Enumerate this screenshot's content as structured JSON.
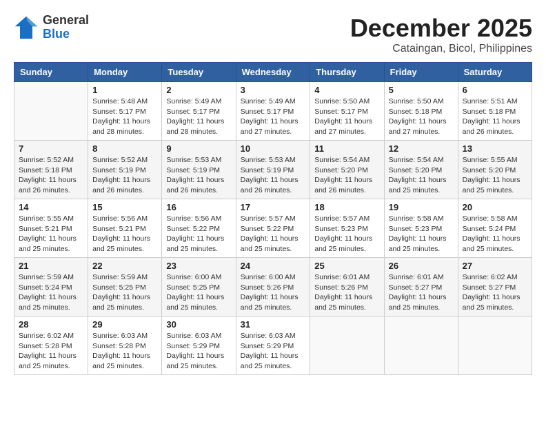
{
  "header": {
    "logo_line1": "General",
    "logo_line2": "Blue",
    "month": "December 2025",
    "location": "Cataingan, Bicol, Philippines"
  },
  "weekdays": [
    "Sunday",
    "Monday",
    "Tuesday",
    "Wednesday",
    "Thursday",
    "Friday",
    "Saturday"
  ],
  "weeks": [
    [
      {
        "day": "",
        "info": ""
      },
      {
        "day": "1",
        "info": "Sunrise: 5:48 AM\nSunset: 5:17 PM\nDaylight: 11 hours and 28 minutes."
      },
      {
        "day": "2",
        "info": "Sunrise: 5:49 AM\nSunset: 5:17 PM\nDaylight: 11 hours and 28 minutes."
      },
      {
        "day": "3",
        "info": "Sunrise: 5:49 AM\nSunset: 5:17 PM\nDaylight: 11 hours and 27 minutes."
      },
      {
        "day": "4",
        "info": "Sunrise: 5:50 AM\nSunset: 5:17 PM\nDaylight: 11 hours and 27 minutes."
      },
      {
        "day": "5",
        "info": "Sunrise: 5:50 AM\nSunset: 5:18 PM\nDaylight: 11 hours and 27 minutes."
      },
      {
        "day": "6",
        "info": "Sunrise: 5:51 AM\nSunset: 5:18 PM\nDaylight: 11 hours and 26 minutes."
      }
    ],
    [
      {
        "day": "7",
        "info": "Sunrise: 5:52 AM\nSunset: 5:18 PM\nDaylight: 11 hours and 26 minutes."
      },
      {
        "day": "8",
        "info": "Sunrise: 5:52 AM\nSunset: 5:19 PM\nDaylight: 11 hours and 26 minutes."
      },
      {
        "day": "9",
        "info": "Sunrise: 5:53 AM\nSunset: 5:19 PM\nDaylight: 11 hours and 26 minutes."
      },
      {
        "day": "10",
        "info": "Sunrise: 5:53 AM\nSunset: 5:19 PM\nDaylight: 11 hours and 26 minutes."
      },
      {
        "day": "11",
        "info": "Sunrise: 5:54 AM\nSunset: 5:20 PM\nDaylight: 11 hours and 26 minutes."
      },
      {
        "day": "12",
        "info": "Sunrise: 5:54 AM\nSunset: 5:20 PM\nDaylight: 11 hours and 25 minutes."
      },
      {
        "day": "13",
        "info": "Sunrise: 5:55 AM\nSunset: 5:20 PM\nDaylight: 11 hours and 25 minutes."
      }
    ],
    [
      {
        "day": "14",
        "info": "Sunrise: 5:55 AM\nSunset: 5:21 PM\nDaylight: 11 hours and 25 minutes."
      },
      {
        "day": "15",
        "info": "Sunrise: 5:56 AM\nSunset: 5:21 PM\nDaylight: 11 hours and 25 minutes."
      },
      {
        "day": "16",
        "info": "Sunrise: 5:56 AM\nSunset: 5:22 PM\nDaylight: 11 hours and 25 minutes."
      },
      {
        "day": "17",
        "info": "Sunrise: 5:57 AM\nSunset: 5:22 PM\nDaylight: 11 hours and 25 minutes."
      },
      {
        "day": "18",
        "info": "Sunrise: 5:57 AM\nSunset: 5:23 PM\nDaylight: 11 hours and 25 minutes."
      },
      {
        "day": "19",
        "info": "Sunrise: 5:58 AM\nSunset: 5:23 PM\nDaylight: 11 hours and 25 minutes."
      },
      {
        "day": "20",
        "info": "Sunrise: 5:58 AM\nSunset: 5:24 PM\nDaylight: 11 hours and 25 minutes."
      }
    ],
    [
      {
        "day": "21",
        "info": "Sunrise: 5:59 AM\nSunset: 5:24 PM\nDaylight: 11 hours and 25 minutes."
      },
      {
        "day": "22",
        "info": "Sunrise: 5:59 AM\nSunset: 5:25 PM\nDaylight: 11 hours and 25 minutes."
      },
      {
        "day": "23",
        "info": "Sunrise: 6:00 AM\nSunset: 5:25 PM\nDaylight: 11 hours and 25 minutes."
      },
      {
        "day": "24",
        "info": "Sunrise: 6:00 AM\nSunset: 5:26 PM\nDaylight: 11 hours and 25 minutes."
      },
      {
        "day": "25",
        "info": "Sunrise: 6:01 AM\nSunset: 5:26 PM\nDaylight: 11 hours and 25 minutes."
      },
      {
        "day": "26",
        "info": "Sunrise: 6:01 AM\nSunset: 5:27 PM\nDaylight: 11 hours and 25 minutes."
      },
      {
        "day": "27",
        "info": "Sunrise: 6:02 AM\nSunset: 5:27 PM\nDaylight: 11 hours and 25 minutes."
      }
    ],
    [
      {
        "day": "28",
        "info": "Sunrise: 6:02 AM\nSunset: 5:28 PM\nDaylight: 11 hours and 25 minutes."
      },
      {
        "day": "29",
        "info": "Sunrise: 6:03 AM\nSunset: 5:28 PM\nDaylight: 11 hours and 25 minutes."
      },
      {
        "day": "30",
        "info": "Sunrise: 6:03 AM\nSunset: 5:29 PM\nDaylight: 11 hours and 25 minutes."
      },
      {
        "day": "31",
        "info": "Sunrise: 6:03 AM\nSunset: 5:29 PM\nDaylight: 11 hours and 25 minutes."
      },
      {
        "day": "",
        "info": ""
      },
      {
        "day": "",
        "info": ""
      },
      {
        "day": "",
        "info": ""
      }
    ]
  ]
}
